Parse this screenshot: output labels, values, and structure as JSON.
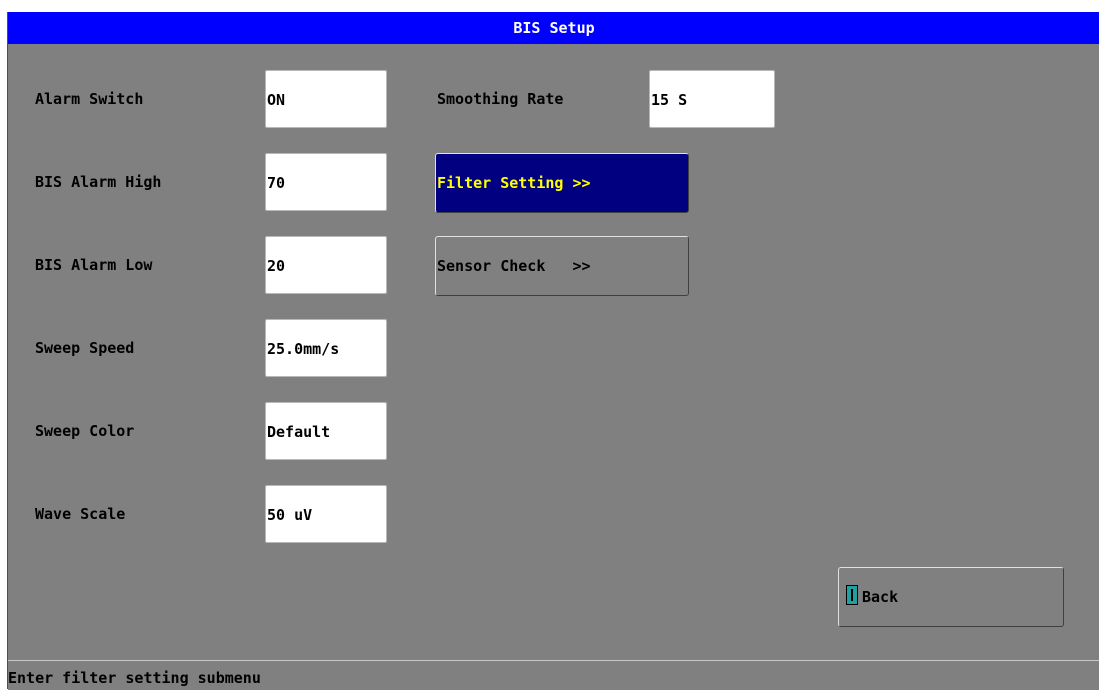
{
  "title": "BIS Setup",
  "fields": [
    {
      "label": "Alarm Switch",
      "value": "ON"
    },
    {
      "label": "BIS Alarm High",
      "value": "70"
    },
    {
      "label": "BIS Alarm Low",
      "value": "20"
    },
    {
      "label": "Sweep Speed",
      "value": "25.0mm/s"
    },
    {
      "label": "Sweep Color",
      "value": "Default"
    },
    {
      "label": "Wave Scale",
      "value": "50 uV"
    }
  ],
  "smoothing": {
    "label": "Smoothing Rate",
    "value": "15 S"
  },
  "buttons": {
    "filter_setting": "Filter Setting >>",
    "sensor_check": "Sensor Check   >>",
    "back": "Back"
  },
  "status": "Enter filter setting submenu",
  "colors": {
    "title_bar": "#0000ff",
    "focus_bg": "#000080",
    "focus_text": "#ffff00",
    "panel": "#808080"
  },
  "icons": {
    "back": "door-exit-icon"
  }
}
